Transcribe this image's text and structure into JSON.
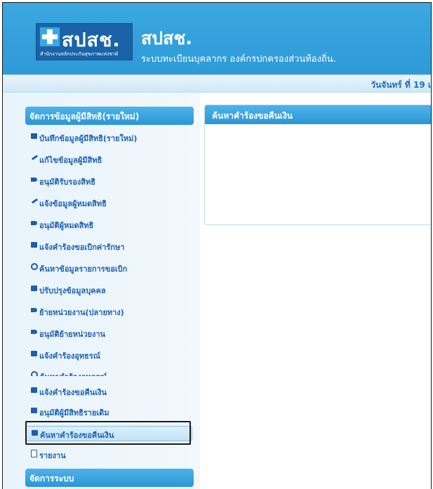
{
  "header": {
    "logo_text": "สปสช.",
    "logo_tagline": "สำนักงานหลักประกันสุขภาพแห่งชาติ",
    "title": "สปสช.",
    "subtitle": "ระบบทะเบียนบุคลากร องค์กรปกครองส่วนท้องถิ่น."
  },
  "date_bar": {
    "text": "วันจันทร์ ที่ 19 เ"
  },
  "sidebar": {
    "section1_title": "จัดการข้อมูลผู้มีสิทธิ(รายใหม่)",
    "items": [
      {
        "label": "บันทึกข้อมูลผู้มีสิทธิ(รายใหม่)",
        "icon": "save-icon"
      },
      {
        "label": "แก้ไขข้อมูลผู้มีสิทธิ",
        "icon": "wrench-icon"
      },
      {
        "label": "อนุมัติรับรองสิทธิ",
        "icon": "flag-icon"
      },
      {
        "label": "แจ้งข้อมูลผู้หมดสิทธิ",
        "icon": "pen-icon"
      },
      {
        "label": "อนุมัติผู้หมดสิทธิ",
        "icon": "flag-icon"
      },
      {
        "label": "แจ้งคำร้องขอเบิกค่ารักษา",
        "icon": "save-icon"
      },
      {
        "label": "ค้นหาข้อมูลรายการขอเบิก",
        "icon": "search-icon"
      },
      {
        "label": "ปรับปรุงข้อมูลบุคคล",
        "icon": "save-icon"
      },
      {
        "label": "ย้ายหน่วยงาน(ปลายทาง)",
        "icon": "flag-icon"
      },
      {
        "label": "อนุมัติย้ายหน่วยงาน",
        "icon": "flag-icon"
      },
      {
        "label": "แจ้งคำร้องอุทธรณ์",
        "icon": "save-icon"
      },
      {
        "label": "ค้นหาคำร้องอุทธรณ์",
        "icon": "search-icon"
      },
      {
        "label": "แจ้งคำร้องขอคืนเงิน",
        "icon": "save-icon"
      },
      {
        "label": "อนุมัติผู้มีสิทธิรายเดิม",
        "icon": "save-icon"
      },
      {
        "label": "ค้นหาคำร้องขอคืนเงิน",
        "icon": "save-icon"
      },
      {
        "label": "รายงาน",
        "icon": "document-icon"
      }
    ],
    "section2_title": "จัดการระบบ"
  },
  "content": {
    "panel_title": "ค้นหาคำร้องขอคืนเงิน"
  },
  "colors": {
    "header_blue": "#33a0dc",
    "link_blue": "#1d62b0",
    "panel_head": "#2b96d6"
  }
}
